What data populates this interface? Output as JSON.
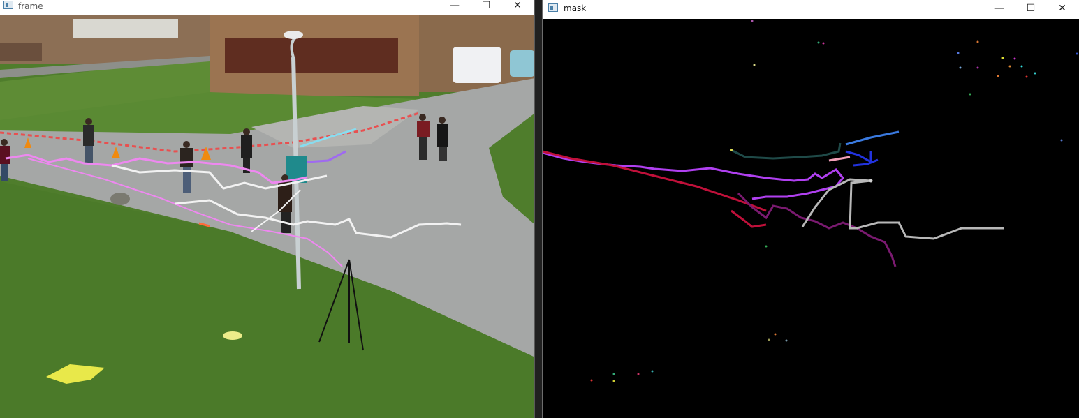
{
  "windows": [
    {
      "title": "frame",
      "controls": {
        "minimize": "—",
        "maximize": "☐",
        "close": "✕"
      },
      "content": "camera frame with motion tracks overlaid"
    },
    {
      "title": "mask",
      "controls": {
        "minimize": "—",
        "maximize": "☐",
        "close": "✕"
      },
      "content": "black mask with colored motion tracks"
    }
  ],
  "colors": {
    "grass": "#4f7d2c",
    "road": "#a5a7a6",
    "brick": "#9b7451",
    "mask_background": "#000000",
    "track_pink": "#ee88f0",
    "track_white": "#f2f2f2",
    "track_violet": "#b040f0",
    "track_crimson": "#c0103a",
    "track_blue": "#2233dd",
    "track_gray": "#b8b8b8",
    "track_purple": "#7a1a70"
  },
  "icons": [
    "app-window-icon",
    "minimize-icon",
    "maximize-icon",
    "close-icon"
  ]
}
